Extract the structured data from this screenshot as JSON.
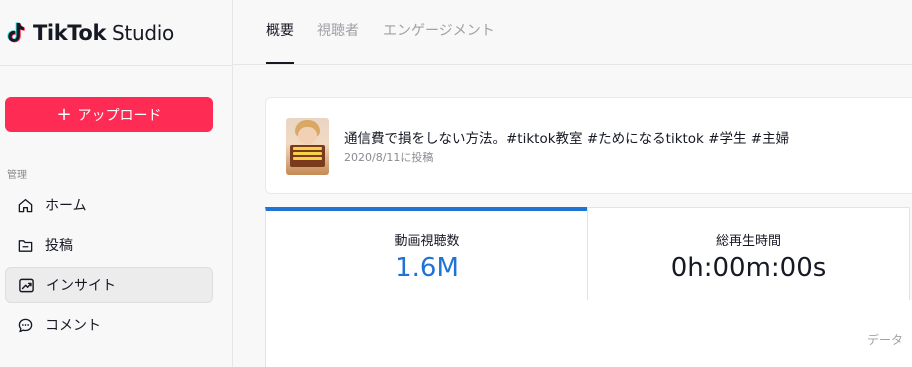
{
  "brand": {
    "logo_text": "TikTok",
    "product": "Studio"
  },
  "sidebar": {
    "upload_label": "アップロード",
    "section_label": "管理",
    "items": [
      {
        "label": "ホーム",
        "icon": "home-icon"
      },
      {
        "label": "投稿",
        "icon": "folder-icon"
      },
      {
        "label": "インサイト",
        "icon": "insights-icon",
        "active": true
      },
      {
        "label": "コメント",
        "icon": "comment-icon"
      }
    ]
  },
  "tabs": [
    {
      "label": "概要",
      "active": true
    },
    {
      "label": "視聴者"
    },
    {
      "label": "エンゲージメント"
    }
  ],
  "video": {
    "title": "通信費で損をしない方法。#tiktok教室 #ためになるtiktok #学生 #主婦",
    "posted_date": "2020/8/11に投稿"
  },
  "metrics": [
    {
      "label": "動画視聴数",
      "value": "1.6M"
    },
    {
      "label": "総再生時間",
      "value": "0h:00m:00s"
    }
  ],
  "footer_note": "データ",
  "colors": {
    "accent": "#fe2c55",
    "metric_blue": "#1e73d4",
    "text": "#161823",
    "muted": "#8a8b91"
  }
}
